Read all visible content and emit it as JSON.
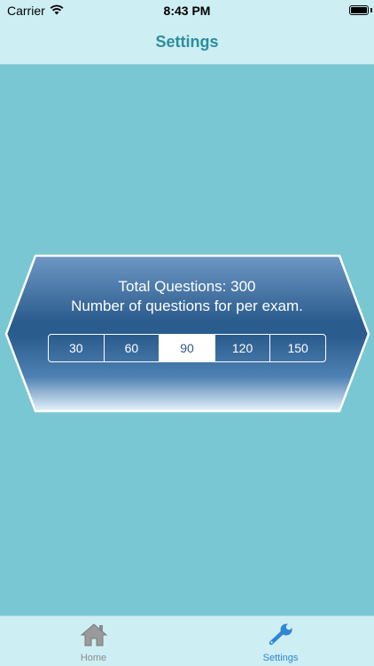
{
  "status_bar": {
    "carrier": "Carrier",
    "time": "8:43 PM"
  },
  "nav": {
    "title": "Settings"
  },
  "panel": {
    "total_questions": "Total Questions: 300",
    "subtitle": "Number of questions for per exam.",
    "options": [
      {
        "label": "30",
        "selected": false
      },
      {
        "label": "60",
        "selected": false
      },
      {
        "label": "90",
        "selected": true
      },
      {
        "label": "120",
        "selected": false
      },
      {
        "label": "150",
        "selected": false
      }
    ]
  },
  "tabs": [
    {
      "label": "Home",
      "icon": "home-icon",
      "active": false
    },
    {
      "label": "Settings",
      "icon": "wrench-icon",
      "active": true
    }
  ],
  "colors": {
    "background": "#78c7d3",
    "bar_background": "#cdeef3",
    "title": "#2a8f9b",
    "panel_dark": "#2b5c8e",
    "panel_light": "#e6f2fb",
    "active_tab": "#2f86d4",
    "inactive_tab": "#8c8c8c"
  }
}
